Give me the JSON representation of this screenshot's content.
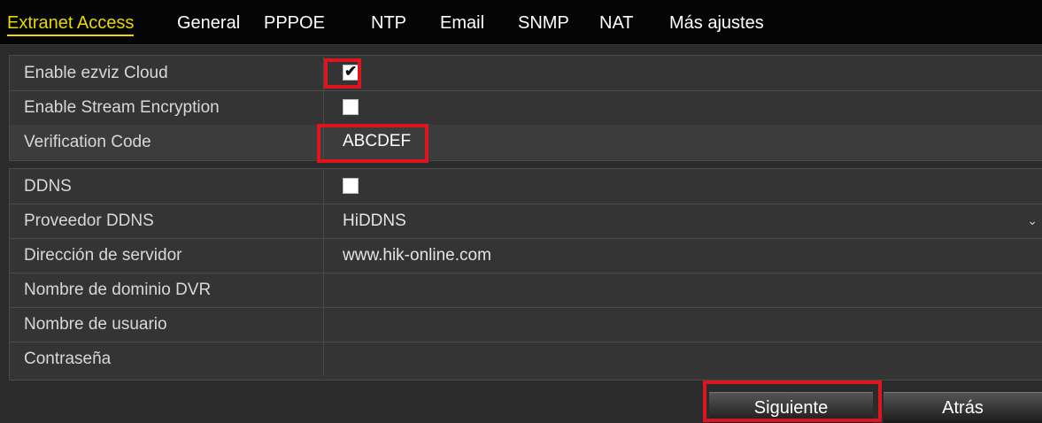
{
  "tabs": [
    {
      "label": "Extranet Access",
      "active": true
    },
    {
      "label": "General"
    },
    {
      "label": "PPPOE"
    },
    {
      "label": "NTP"
    },
    {
      "label": "Email"
    },
    {
      "label": "SNMP"
    },
    {
      "label": "NAT"
    },
    {
      "label": "Más ajustes"
    }
  ],
  "cloud": {
    "enable_ezviz_label": "Enable ezviz Cloud",
    "enable_ezviz_checked": true,
    "stream_encryption_label": "Enable Stream Encryption",
    "stream_encryption_checked": false,
    "verification_code_label": "Verification Code",
    "verification_code_value": "ABCDEF"
  },
  "ddns": {
    "ddns_label": "DDNS",
    "ddns_checked": false,
    "provider_label": "Proveedor DDNS",
    "provider_value": "HiDDNS",
    "server_label": "Dirección de servidor",
    "server_value": "www.hik-online.com",
    "domain_label": "Nombre de dominio DVR",
    "domain_value": "",
    "username_label": "Nombre de usuario",
    "username_value": "",
    "password_label": "Contraseña",
    "password_value": ""
  },
  "buttons": {
    "next_label": "Siguiente",
    "back_label": "Atrás"
  },
  "icons": {
    "checkmark": "check-icon",
    "dropdown": "chevron-down-icon"
  },
  "colors": {
    "active_tab": "#e8d700",
    "highlight_box": "#e0141e"
  }
}
